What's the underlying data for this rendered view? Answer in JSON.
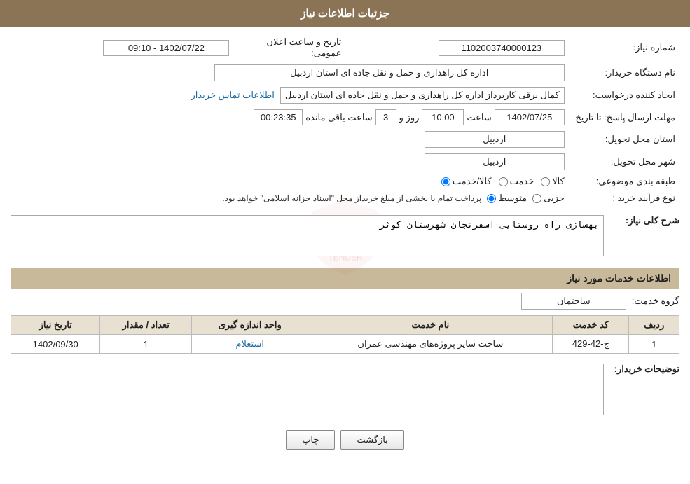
{
  "header": {
    "title": "جزئیات اطلاعات نیاز"
  },
  "fields": {
    "need_number_label": "شماره نیاز:",
    "need_number_value": "1102003740000123",
    "announce_date_label": "تاریخ و ساعت اعلان عمومی:",
    "announce_date_value": "1402/07/22 - 09:10",
    "buyer_org_label": "نام دستگاه خریدار:",
    "buyer_org_value": "اداره کل راهداری و حمل و نقل جاده ای استان اردبیل",
    "requester_label": "ایجاد کننده درخواست:",
    "requester_value": "کمال برقی کاربرداز اداره کل راهداری و حمل و نقل جاده ای استان اردبیل",
    "contact_link": "اطلاعات تماس خریدار",
    "response_deadline_label": "مهلت ارسال پاسخ: تا تاریخ:",
    "response_date": "1402/07/25",
    "response_time_label": "ساعت",
    "response_time": "10:00",
    "response_days_label": "روز و",
    "response_days": "3",
    "response_remaining_label": "ساعت باقی مانده",
    "response_remaining": "00:23:35",
    "province_label": "استان محل تحویل:",
    "province_value": "اردبیل",
    "city_label": "شهر محل تحویل:",
    "city_value": "اردبیل",
    "category_label": "طبقه بندی موضوعی:",
    "category_options": [
      "کالا",
      "خدمت",
      "کالا/خدمت"
    ],
    "category_selected": "کالا",
    "purchase_type_label": "نوع فرآیند خرید :",
    "purchase_types": [
      "جزیی",
      "متوسط"
    ],
    "purchase_note": "پرداخت تمام یا بخشی از مبلغ خریداز محل \"اسناد خزانه اسلامی\" خواهد بود.",
    "general_desc_section": "شرح کلی نیاز:",
    "general_desc_value": "بهسازی راه روستایی اسفرنجان شهرستان کوثر",
    "services_section_title": "اطلاعات خدمات مورد نیاز",
    "service_group_label": "گروه خدمت:",
    "service_group_value": "ساختمان"
  },
  "services_table": {
    "headers": [
      "ردیف",
      "کد خدمت",
      "نام خدمت",
      "واحد اندازه گیری",
      "تعداد / مقدار",
      "تاریخ نیاز"
    ],
    "rows": [
      {
        "row_num": "1",
        "service_code": "ج-42-429",
        "service_name": "ساخت سایر پروژه‌های مهندسی عمران",
        "unit": "استعلام",
        "quantity": "1",
        "date": "1402/09/30"
      }
    ]
  },
  "buyer_notes_label": "توضیحات خریدار:",
  "buyer_notes_value": "",
  "buttons": {
    "print": "چاپ",
    "back": "بازگشت"
  },
  "col_badge": "Col"
}
